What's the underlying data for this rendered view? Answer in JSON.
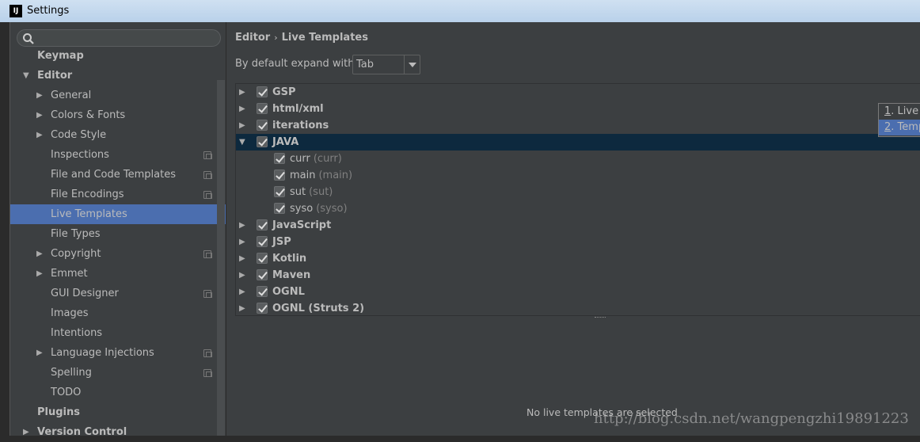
{
  "window": {
    "title": "Settings",
    "logo": "IJ"
  },
  "search": {
    "placeholder": "",
    "icon": "search-icon"
  },
  "sidebar": {
    "items": [
      {
        "label": "Keymap",
        "level": 0,
        "bold": true
      },
      {
        "label": "Editor",
        "level": 0,
        "bold": true,
        "expanded": true
      },
      {
        "label": "General",
        "level": 1,
        "arrow": true
      },
      {
        "label": "Colors & Fonts",
        "level": 1,
        "arrow": true
      },
      {
        "label": "Code Style",
        "level": 1,
        "arrow": true
      },
      {
        "label": "Inspections",
        "level": 1,
        "project": true
      },
      {
        "label": "File and Code Templates",
        "level": 1,
        "project": true
      },
      {
        "label": "File Encodings",
        "level": 1,
        "project": true
      },
      {
        "label": "Live Templates",
        "level": 1,
        "selected": true
      },
      {
        "label": "File Types",
        "level": 1
      },
      {
        "label": "Copyright",
        "level": 1,
        "arrow": true,
        "project": true
      },
      {
        "label": "Emmet",
        "level": 1,
        "arrow": true
      },
      {
        "label": "GUI Designer",
        "level": 1,
        "project": true
      },
      {
        "label": "Images",
        "level": 1
      },
      {
        "label": "Intentions",
        "level": 1
      },
      {
        "label": "Language Injections",
        "level": 1,
        "arrow": true,
        "project": true
      },
      {
        "label": "Spelling",
        "level": 1,
        "project": true
      },
      {
        "label": "TODO",
        "level": 1
      },
      {
        "label": "Plugins",
        "level": 0,
        "bold": true
      },
      {
        "label": "Version Control",
        "level": 0,
        "bold": true,
        "arrow": true
      }
    ]
  },
  "main": {
    "breadcrumb": {
      "parent": "Editor",
      "sep": "›",
      "current": "Live Templates"
    },
    "expand_label": "By default expand with",
    "expand_value": "Tab",
    "templates": [
      {
        "name": "GSP",
        "group": true,
        "checked": true
      },
      {
        "name": "html/xml",
        "group": true,
        "checked": true
      },
      {
        "name": "iterations",
        "group": true,
        "checked": true
      },
      {
        "name": "JAVA",
        "group": true,
        "checked": true,
        "expanded": true,
        "selected": true
      },
      {
        "name": "curr",
        "abbr": "(curr)",
        "checked": true
      },
      {
        "name": "main",
        "abbr": "(main)",
        "checked": true
      },
      {
        "name": "sut",
        "abbr": "(sut)",
        "checked": true
      },
      {
        "name": "syso",
        "abbr": "(syso)",
        "checked": true
      },
      {
        "name": "JavaScript",
        "group": true,
        "checked": true
      },
      {
        "name": "JSP",
        "group": true,
        "checked": true
      },
      {
        "name": "Kotlin",
        "group": true,
        "checked": true
      },
      {
        "name": "Maven",
        "group": true,
        "checked": true
      },
      {
        "name": "OGNL",
        "group": true,
        "checked": true
      },
      {
        "name": "OGNL (Struts 2)",
        "group": true,
        "checked": true
      }
    ],
    "empty_text": "No live templates are selected"
  },
  "popup": {
    "items": [
      {
        "num": "1",
        "label": ". Live T"
      },
      {
        "num": "2",
        "label": ". Temp"
      }
    ]
  },
  "watermark": "http://blog.csdn.net/wangpengzhi19891223",
  "colors": {
    "background": "#3c3f41",
    "selection": "#4b6eaf",
    "tree_selection": "#0d293e"
  }
}
